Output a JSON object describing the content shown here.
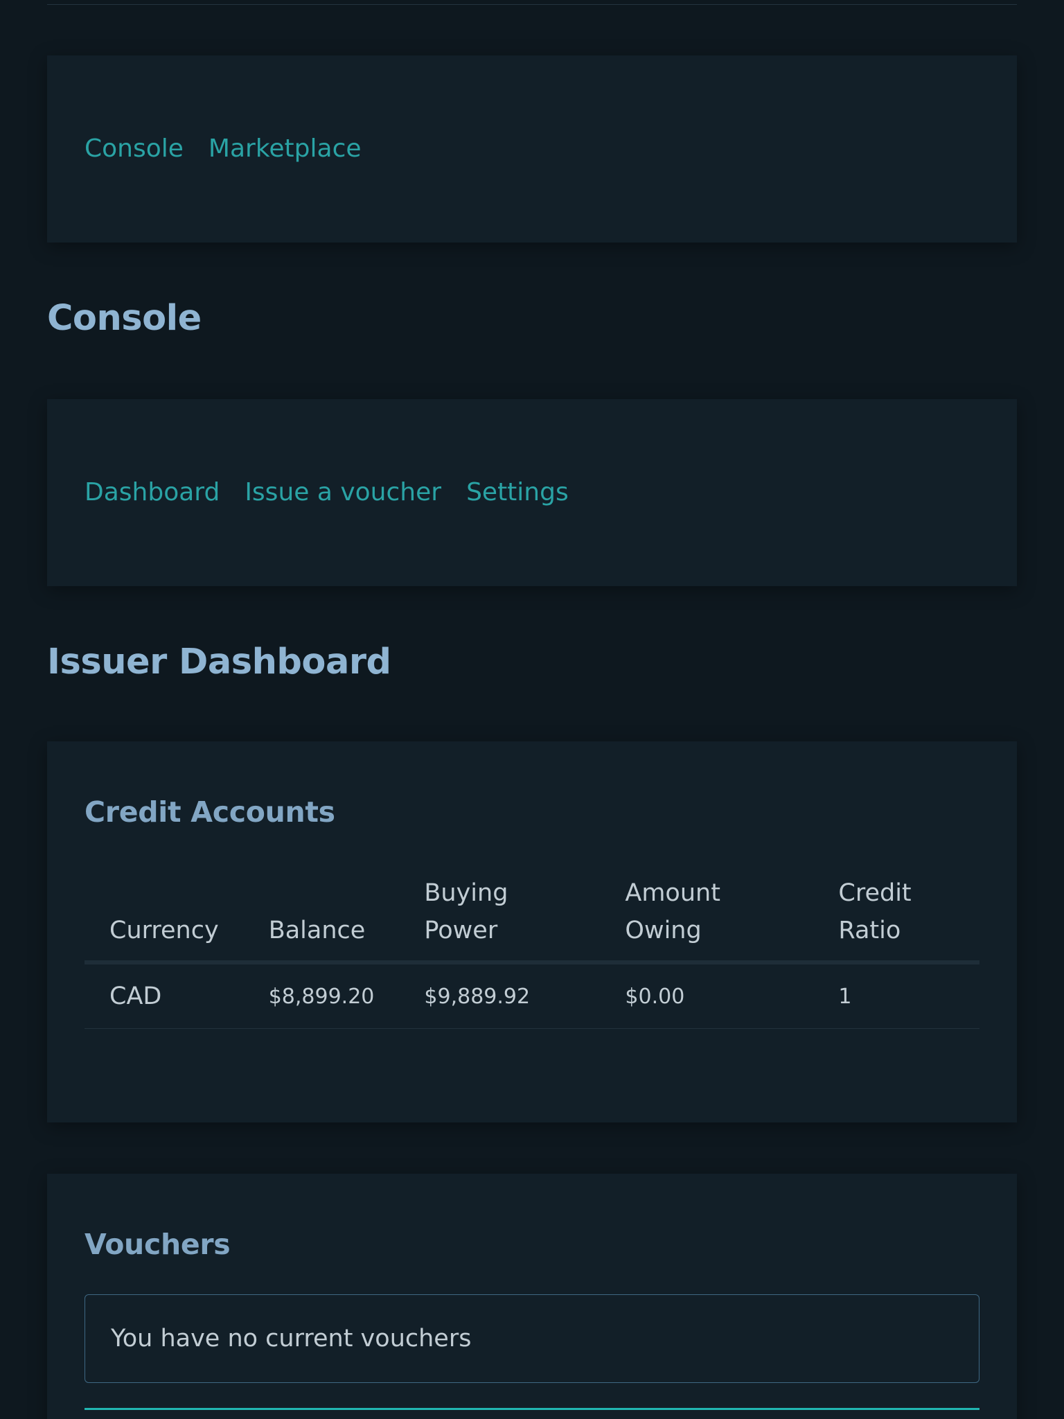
{
  "top_nav": {
    "links": [
      {
        "label": "Console"
      },
      {
        "label": "Marketplace"
      }
    ]
  },
  "console": {
    "title": "Console",
    "links": [
      {
        "label": "Dashboard"
      },
      {
        "label": "Issue a voucher"
      },
      {
        "label": "Settings"
      }
    ]
  },
  "dashboard": {
    "title": "Issuer Dashboard"
  },
  "credit_accounts": {
    "title": "Credit Accounts",
    "columns": [
      {
        "line1": "Currency",
        "line2": ""
      },
      {
        "line1": "Balance",
        "line2": ""
      },
      {
        "line1": "Buying",
        "line2": "Power"
      },
      {
        "line1": "Amount",
        "line2": "Owing"
      },
      {
        "line1": "Credit",
        "line2": "Ratio"
      }
    ],
    "rows": [
      {
        "currency": "CAD",
        "balance": "$8,899.20",
        "buying_power": "$9,889.92",
        "amount_owing": "$0.00",
        "credit_ratio": "1"
      }
    ]
  },
  "vouchers": {
    "title": "Vouchers",
    "empty_message": "You have no current vouchers"
  },
  "colors": {
    "background": "#0e181f",
    "card": "#121f28",
    "link": "#2aa3a5",
    "heading": "#8fb4d2",
    "accent": "#21b6b1"
  }
}
